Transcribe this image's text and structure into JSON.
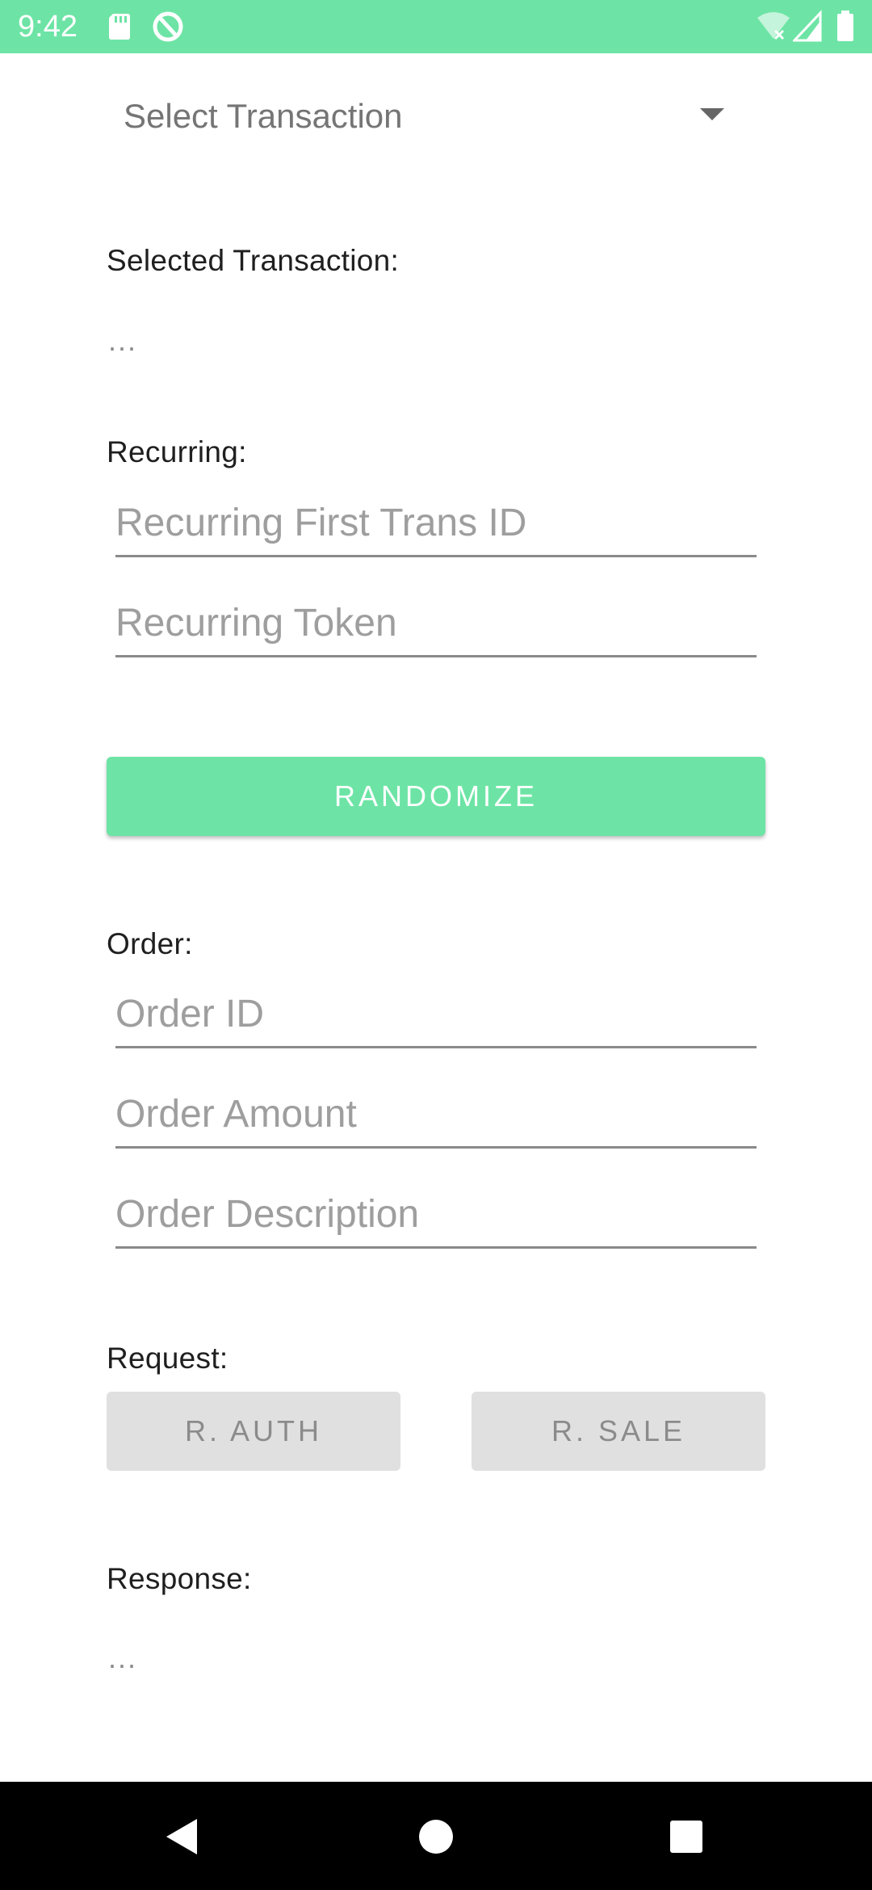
{
  "status_bar": {
    "time": "9:42",
    "background_color": "#6de4a5",
    "left_icons": [
      "sd-card-icon",
      "sync-disabled-icon"
    ],
    "right_icons": [
      "wifi-off-icon",
      "cellular-signal-icon",
      "battery-icon"
    ]
  },
  "spinner": {
    "selected_text": "Select Transaction"
  },
  "selected_transaction": {
    "label": "Selected Transaction:",
    "value": "..."
  },
  "recurring": {
    "label": "Recurring:",
    "first_trans_id_placeholder": "Recurring First Trans ID",
    "first_trans_id_value": "",
    "token_placeholder": "Recurring Token",
    "token_value": ""
  },
  "randomize_button": {
    "label": "RANDOMIZE",
    "color": "#6de4a5"
  },
  "order": {
    "label": "Order:",
    "id_placeholder": "Order ID",
    "id_value": "",
    "amount_placeholder": "Order Amount",
    "amount_value": "",
    "description_placeholder": "Order Description",
    "description_value": ""
  },
  "request": {
    "label": "Request:",
    "auth_button_label": "R. AUTH",
    "sale_button_label": "R. SALE"
  },
  "response": {
    "label": "Response:",
    "value": "..."
  },
  "nav_bar": {
    "icons": [
      "back-icon",
      "home-icon",
      "recents-icon"
    ]
  }
}
